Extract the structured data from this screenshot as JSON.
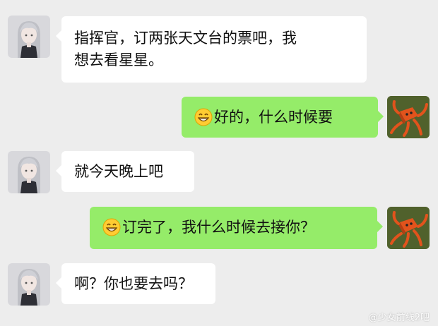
{
  "messages": [
    {
      "side": "in",
      "sender": "girl-avatar",
      "lines": [
        "指挥官，订两张天文台的票吧，我",
        "想去看星星。"
      ]
    },
    {
      "side": "out",
      "sender": "octopus-avatar",
      "emoji": "grinning-face-emoji",
      "text": "好的，什么时候要"
    },
    {
      "side": "in",
      "sender": "girl-avatar",
      "text": "就今天晚上吧"
    },
    {
      "side": "out",
      "sender": "octopus-avatar",
      "emoji": "grinning-face-emoji",
      "text": "订完了，我什么时候去接你？"
    },
    {
      "side": "in",
      "sender": "girl-avatar",
      "text": "啊？你也要去吗？"
    }
  ],
  "watermark": "@少女前线2吧",
  "colors": {
    "background": "#ededed",
    "incoming_bubble": "#ffffff",
    "outgoing_bubble": "#95ec69"
  }
}
